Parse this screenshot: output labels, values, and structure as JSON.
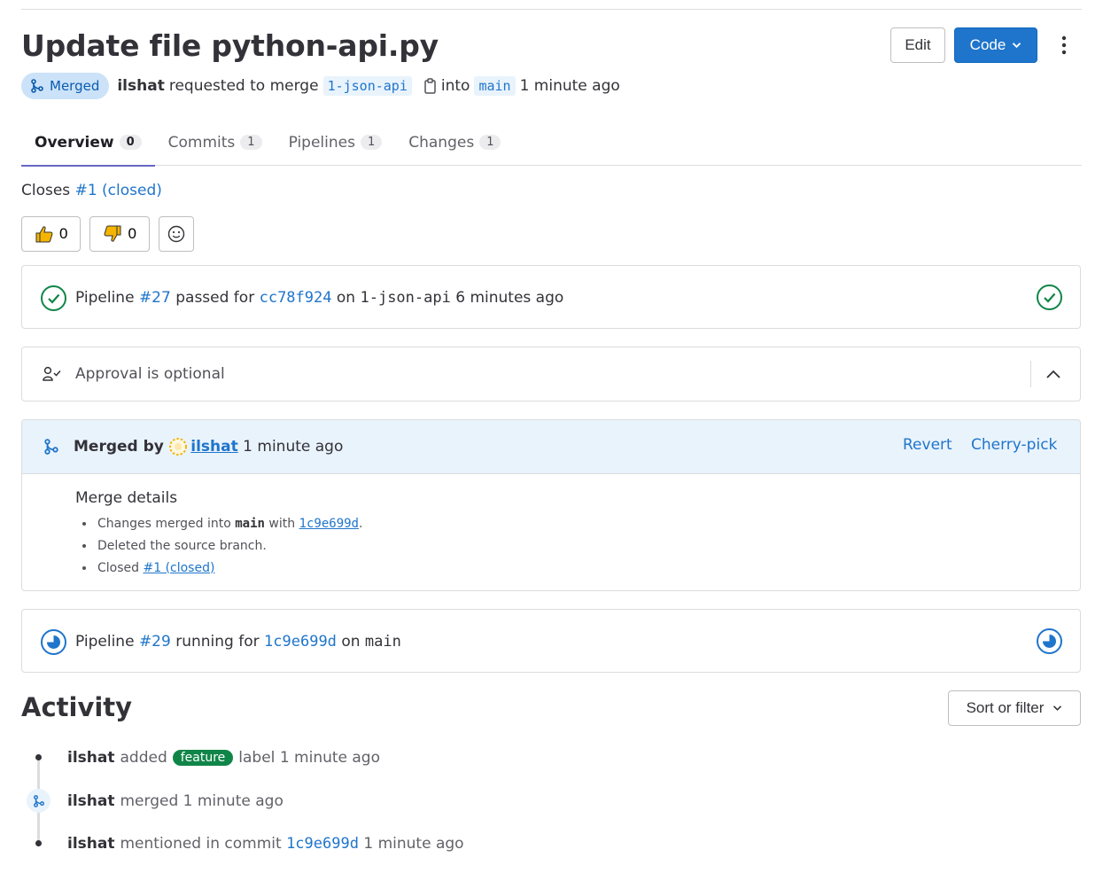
{
  "header": {
    "title": "Update file python-api.py",
    "edit_label": "Edit",
    "code_label": "Code",
    "status": "Merged",
    "author": "ilshat",
    "requested_text": "requested to merge",
    "source_branch": "1-json-api",
    "into_text": "into",
    "target_branch": "main",
    "time": "1 minute ago"
  },
  "tabs": [
    {
      "label": "Overview",
      "count": "0",
      "active": true
    },
    {
      "label": "Commits",
      "count": "1"
    },
    {
      "label": "Pipelines",
      "count": "1"
    },
    {
      "label": "Changes",
      "count": "1"
    }
  ],
  "closes": {
    "prefix": "Closes",
    "link": "#1 (closed)"
  },
  "reactions": {
    "thumbsup_count": "0",
    "thumbsdown_count": "0"
  },
  "pipeline1": {
    "prefix": "Pipeline",
    "id": "#27",
    "status_text": "passed for",
    "commit": "cc78f924",
    "on_text": "on",
    "branch": "1-json-api",
    "time": "6 minutes ago",
    "status": "passed",
    "color": "#108548"
  },
  "approval": {
    "text": "Approval is optional"
  },
  "merged": {
    "prefix": "Merged by",
    "user": "ilshat",
    "time": "1 minute ago",
    "revert_label": "Revert",
    "cherry_label": "Cherry-pick",
    "details_title": "Merge details",
    "detail1_prefix": "Changes merged into",
    "detail1_branch": "main",
    "detail1_with": "with",
    "detail1_commit": "1c9e699d",
    "detail1_suffix": ".",
    "detail2": "Deleted the source branch.",
    "detail3_prefix": "Closed",
    "detail3_link": "#1 (closed)"
  },
  "pipeline2": {
    "prefix": "Pipeline",
    "id": "#29",
    "status_text": "running for",
    "commit": "1c9e699d",
    "on_text": "on",
    "branch": "main",
    "status": "running",
    "color": "#1f75cb"
  },
  "activity": {
    "title": "Activity",
    "sort_label": "Sort or filter",
    "items": [
      {
        "user": "ilshat",
        "action": "added",
        "label": "feature",
        "after": "label",
        "time": "1 minute ago"
      },
      {
        "user": "ilshat",
        "action": "merged",
        "time": "1 minute ago"
      },
      {
        "user": "ilshat",
        "action": "mentioned in commit",
        "commit": "1c9e699d",
        "time": "1 minute ago"
      }
    ]
  },
  "colors": {
    "accent": "#1f75cb",
    "merged_badge_bg": "#cbe2f9",
    "label_feature": "#108548",
    "tab_underline": "#6666c4"
  }
}
